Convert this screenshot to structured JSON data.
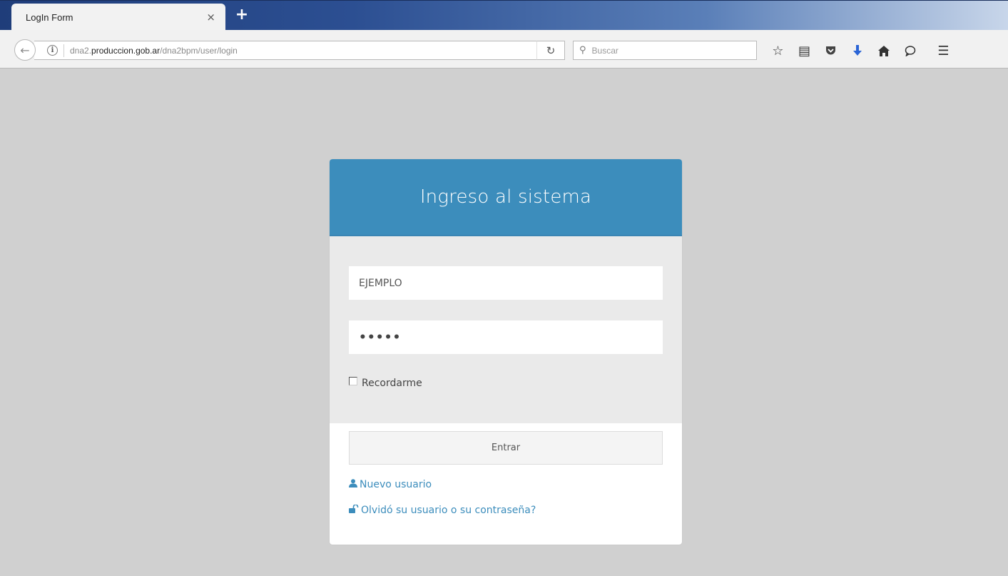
{
  "browser": {
    "tab_title": "LogIn Form",
    "tab_close": "×",
    "new_tab": "+",
    "url_prefix": "dna2.",
    "url_domain": "produccion.gob.ar",
    "url_path": "/dna2bpm/user/login",
    "search_placeholder": "Buscar",
    "icons": [
      "back-arrow",
      "info",
      "reload",
      "search",
      "bookmark-star",
      "reading-list",
      "pocket",
      "download",
      "home",
      "chat",
      "hamburger-menu"
    ]
  },
  "login": {
    "title": "Ingreso al sistema",
    "username_value": "EJEMPLO",
    "password_mask": "•••••",
    "remember_label": "Recordarme",
    "remember_checked": false,
    "submit_label": "Entrar",
    "new_user_label": "Nuevo usuario",
    "forgot_label": "Olvidó su usuario o su contraseña?"
  },
  "colors": {
    "header": "#3c8dbc",
    "link": "#3c8dbc",
    "page_bg": "#d0d0d0",
    "form_bg": "#eaeaea"
  }
}
